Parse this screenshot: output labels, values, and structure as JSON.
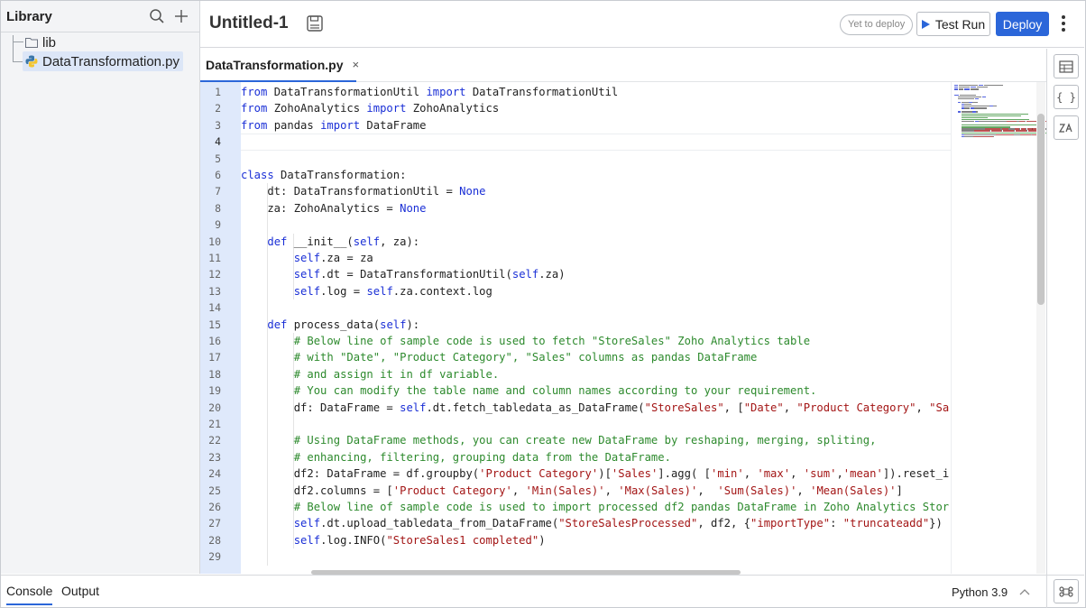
{
  "sidebar": {
    "title": "Library",
    "items": [
      {
        "label": "lib",
        "icon": "folder-icon"
      },
      {
        "label": "DataTransformation.py",
        "icon": "python-file-icon",
        "selected": true
      }
    ]
  },
  "header": {
    "title": "Untitled-1",
    "status": "Yet to deploy",
    "test_run_label": "Test Run",
    "deploy_label": "Deploy"
  },
  "tabs": [
    {
      "label": "DataTransformation.py",
      "close": "×",
      "active": true
    }
  ],
  "editor": {
    "current_line": 4,
    "line_numbers": [
      "1",
      "2",
      "3",
      "4",
      "5",
      "6",
      "7",
      "8",
      "9",
      "10",
      "11",
      "12",
      "13",
      "14",
      "15",
      "16",
      "17",
      "18",
      "19",
      "20",
      "21",
      "22",
      "23",
      "24",
      "25",
      "26",
      "27",
      "28",
      "29"
    ],
    "lines": [
      [
        [
          "kw",
          "from"
        ],
        [
          "txt",
          " DataTransformationUtil "
        ],
        [
          "kw",
          "import"
        ],
        [
          "txt",
          " DataTransformationUtil"
        ]
      ],
      [
        [
          "kw",
          "from"
        ],
        [
          "txt",
          " ZohoAnalytics "
        ],
        [
          "kw",
          "import"
        ],
        [
          "txt",
          " ZohoAnalytics"
        ]
      ],
      [
        [
          "kw",
          "from"
        ],
        [
          "txt",
          " pandas "
        ],
        [
          "kw",
          "import"
        ],
        [
          "txt",
          " DataFrame"
        ]
      ],
      [],
      [],
      [
        [
          "kw",
          "class"
        ],
        [
          "txt",
          " DataTransformation:"
        ]
      ],
      [
        [
          "txt",
          "    dt: DataTransformationUtil = "
        ],
        [
          "kw",
          "None"
        ]
      ],
      [
        [
          "txt",
          "    za: ZohoAnalytics = "
        ],
        [
          "kw",
          "None"
        ]
      ],
      [],
      [
        [
          "txt",
          "    "
        ],
        [
          "kw",
          "def"
        ],
        [
          "txt",
          " __init__("
        ],
        [
          "kw",
          "self"
        ],
        [
          "txt",
          ", za):"
        ]
      ],
      [
        [
          "txt",
          "        "
        ],
        [
          "kw",
          "self"
        ],
        [
          "txt",
          ".za = za"
        ]
      ],
      [
        [
          "txt",
          "        "
        ],
        [
          "kw",
          "self"
        ],
        [
          "txt",
          ".dt = DataTransformationUtil("
        ],
        [
          "kw",
          "self"
        ],
        [
          "txt",
          ".za)"
        ]
      ],
      [
        [
          "txt",
          "        "
        ],
        [
          "kw",
          "self"
        ],
        [
          "txt",
          ".log = "
        ],
        [
          "kw",
          "self"
        ],
        [
          "txt",
          ".za.context.log"
        ]
      ],
      [],
      [
        [
          "txt",
          "    "
        ],
        [
          "kw",
          "def"
        ],
        [
          "txt",
          " process_data("
        ],
        [
          "kw",
          "self"
        ],
        [
          "txt",
          "):"
        ]
      ],
      [
        [
          "txt",
          "        "
        ],
        [
          "cmt",
          "# Below line of sample code is used to fetch \"StoreSales\" Zoho Analytics table"
        ]
      ],
      [
        [
          "txt",
          "        "
        ],
        [
          "cmt",
          "# with \"Date\", \"Product Category\", \"Sales\" columns as pandas DataFrame"
        ]
      ],
      [
        [
          "txt",
          "        "
        ],
        [
          "cmt",
          "# and assign it in df variable."
        ]
      ],
      [
        [
          "txt",
          "        "
        ],
        [
          "cmt",
          "# You can modify the table name and column names according to your requirement."
        ]
      ],
      [
        [
          "txt",
          "        df: DataFrame = "
        ],
        [
          "kw",
          "self"
        ],
        [
          "txt",
          ".dt.fetch_tabledata_as_DataFrame("
        ],
        [
          "str",
          "\"StoreSales\""
        ],
        [
          "txt",
          ", ["
        ],
        [
          "str",
          "\"Date\""
        ],
        [
          "txt",
          ", "
        ],
        [
          "str",
          "\"Product Category\""
        ],
        [
          "txt",
          ", "
        ],
        [
          "str",
          "\"Sa"
        ]
      ],
      [],
      [
        [
          "txt",
          "        "
        ],
        [
          "cmt",
          "# Using DataFrame methods, you can create new DataFrame by reshaping, merging, spliting,"
        ]
      ],
      [
        [
          "txt",
          "        "
        ],
        [
          "cmt",
          "# enhancing, filtering, grouping data from the DataFrame."
        ]
      ],
      [
        [
          "txt",
          "        df2: DataFrame = df.groupby("
        ],
        [
          "str",
          "'Product Category'"
        ],
        [
          "txt",
          ")["
        ],
        [
          "str",
          "'Sales'"
        ],
        [
          "txt",
          "].agg( ["
        ],
        [
          "str",
          "'min'"
        ],
        [
          "txt",
          ", "
        ],
        [
          "str",
          "'max'"
        ],
        [
          "txt",
          ", "
        ],
        [
          "str",
          "'sum'"
        ],
        [
          "txt",
          ","
        ],
        [
          "str",
          "'mean'"
        ],
        [
          "txt",
          "]).reset_i"
        ]
      ],
      [
        [
          "txt",
          "        df2.columns = ["
        ],
        [
          "str",
          "'Product Category'"
        ],
        [
          "txt",
          ", "
        ],
        [
          "str",
          "'Min(Sales)'"
        ],
        [
          "txt",
          ", "
        ],
        [
          "str",
          "'Max(Sales)'"
        ],
        [
          "txt",
          ",  "
        ],
        [
          "str",
          "'Sum(Sales)'"
        ],
        [
          "txt",
          ", "
        ],
        [
          "str",
          "'Mean(Sales)'"
        ],
        [
          "txt",
          "]"
        ]
      ],
      [
        [
          "txt",
          "        "
        ],
        [
          "cmt",
          "# Below line of sample code is used to import processed df2 pandas DataFrame in Zoho Analytics Stor"
        ]
      ],
      [
        [
          "txt",
          "        "
        ],
        [
          "kw",
          "self"
        ],
        [
          "txt",
          ".dt.upload_tabledata_from_DataFrame("
        ],
        [
          "str",
          "\"StoreSalesProcessed\""
        ],
        [
          "txt",
          ", df2, {"
        ],
        [
          "str",
          "\"importType\""
        ],
        [
          "txt",
          ": "
        ],
        [
          "str",
          "\"truncateadd\""
        ],
        [
          "txt",
          "})"
        ]
      ],
      [
        [
          "txt",
          "        "
        ],
        [
          "kw",
          "self"
        ],
        [
          "txt",
          ".log.INFO("
        ],
        [
          "str",
          "\"StoreSales1 completed\""
        ],
        [
          "txt",
          ")"
        ]
      ],
      []
    ]
  },
  "bottom": {
    "tabs": [
      "Console",
      "Output"
    ],
    "active_tab": "Console",
    "runtime": "Python 3.9"
  },
  "colors": {
    "accent": "#2b66d9",
    "keyword": "#1a2fd6",
    "string": "#a31515",
    "comment": "#2d8a2d",
    "gutter": "#dfe9fb"
  }
}
